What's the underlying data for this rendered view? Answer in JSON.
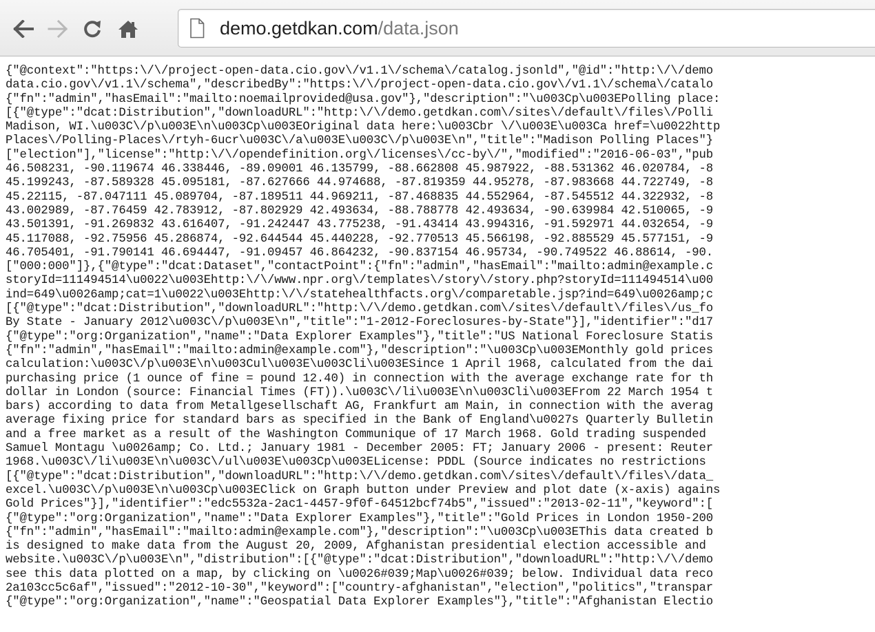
{
  "window": {
    "nav": {
      "back_icon": "arrow-left-icon",
      "forward_icon": "arrow-right-icon",
      "reload_icon": "reload-icon",
      "home_icon": "home-icon"
    },
    "address_bar": {
      "page_icon": "page-icon",
      "host": "demo.getdkan.com",
      "path": "/data.json"
    }
  },
  "document": {
    "lines": [
      "{\"@context\":\"https:\\/\\/project-open-data.cio.gov\\/v1.1\\/schema\\/catalog.jsonld\",\"@id\":\"http:\\/\\/demo",
      "data.cio.gov\\/v1.1\\/schema\",\"describedBy\":\"https:\\/\\/project-open-data.cio.gov\\/v1.1\\/schema\\/catalo",
      "{\"fn\":\"admin\",\"hasEmail\":\"mailto:noemailprovided@usa.gov\"},\"description\":\"\\u003Cp\\u003EPolling place:",
      "[{\"@type\":\"dcat:Distribution\",\"downloadURL\":\"http:\\/\\/demo.getdkan.com\\/sites\\/default\\/files\\/Polli",
      "Madison, WI.\\u003C\\/p\\u003E\\n\\u003Cp\\u003EOriginal data here:\\u003Cbr \\/\\u003E\\u003Ca href=\\u0022http",
      "Places\\/Polling-Places\\/rtyh-6ucr\\u003C\\/a\\u003E\\u003C\\/p\\u003E\\n\",\"title\":\"Madison Polling Places\"}",
      "[\"election\"],\"license\":\"http:\\/\\/opendefinition.org\\/licenses\\/cc-by\\/\",\"modified\":\"2016-06-03\",\"pub",
      "46.508231, -90.119674 46.338446, -89.09001 46.135799, -88.662808 45.987922, -88.531362 46.020784, -8",
      "45.199243, -87.589328 45.095181, -87.627666 44.974688, -87.819359 44.95278, -87.983668 44.722749, -8",
      "45.22115, -87.047111 45.089704, -87.189511 44.969211, -87.468835 44.552964, -87.545512 44.322932, -8",
      "43.002989, -87.76459 42.783912, -87.802929 42.493634, -88.788778 42.493634, -90.639984 42.510065, -9",
      "43.501391, -91.269832 43.616407, -91.242447 43.775238, -91.43414 43.994316, -91.592971 44.032654, -9",
      "45.117088, -92.75956 45.286874, -92.644544 45.440228, -92.770513 45.566198, -92.885529 45.577151, -9",
      "46.705401, -91.790141 46.694447, -91.09457 46.864232, -90.837154 46.95734, -90.749522 46.88614, -90.",
      "[\"000:000\"]},{\"@type\":\"dcat:Dataset\",\"contactPoint\":{\"fn\":\"admin\",\"hasEmail\":\"mailto:admin@example.c",
      "storyId=111494514\\u0022\\u003Ehttp:\\/\\/www.npr.org\\/templates\\/story\\/story.php?storyId=111494514\\u00",
      "ind=649\\u0026amp;cat=1\\u0022\\u003Ehttp:\\/\\/statehealthfacts.org\\/comparetable.jsp?ind=649\\u0026amp;c",
      "[{\"@type\":\"dcat:Distribution\",\"downloadURL\":\"http:\\/\\/demo.getdkan.com\\/sites\\/default\\/files\\/us_fo",
      "By State - January 2012\\u003C\\/p\\u003E\\n\",\"title\":\"1-2012-Foreclosures-by-State\"}],\"identifier\":\"d17",
      "{\"@type\":\"org:Organization\",\"name\":\"Data Explorer Examples\"},\"title\":\"US National Foreclosure Statis",
      "{\"fn\":\"admin\",\"hasEmail\":\"mailto:admin@example.com\"},\"description\":\"\\u003Cp\\u003EMonthly gold prices",
      "calculation:\\u003C\\/p\\u003E\\n\\u003Cul\\u003E\\u003Cli\\u003ESince 1 April 1968, calculated from the dai",
      "purchasing price (1 ounce of fine = pound 12.40) in connection with the average exchange rate for th",
      "dollar in London (source: Financial Times (FT)).\\u003C\\/li\\u003E\\n\\u003Cli\\u003EFrom 22 March 1954 t",
      "bars) according to data from Metallgesellschaft AG, Frankfurt am Main, in connection with the averag",
      "average fixing price for standard bars as specified in the Bank of England\\u0027s Quarterly Bulletin",
      "and a free market as a result of the Washington Communique of 17 March 1968. Gold trading suspended",
      "Samuel Montagu \\u0026amp; Co. Ltd.; January 1981 - December 2005: FT; January 2006 - present: Reuter",
      "1968.\\u003C\\/li\\u003E\\n\\u003C\\/ul\\u003E\\u003Cp\\u003ELicense: PDDL (Source indicates no restrictions",
      "[{\"@type\":\"dcat:Distribution\",\"downloadURL\":\"http:\\/\\/demo.getdkan.com\\/sites\\/default\\/files\\/data_",
      "excel.\\u003C\\/p\\u003E\\n\\u003Cp\\u003EClick on Graph button under Preview and plot date (x-axis) agains",
      "Gold Prices\"}],\"identifier\":\"edc5532a-2ac1-4457-9f0f-64512bcf74b5\",\"issued\":\"2013-02-11\",\"keyword\":[",
      "{\"@type\":\"org:Organization\",\"name\":\"Data Explorer Examples\"},\"title\":\"Gold Prices in London 1950-200",
      "{\"fn\":\"admin\",\"hasEmail\":\"mailto:admin@example.com\"},\"description\":\"\\u003Cp\\u003EThis data created b",
      "is designed to make data from the August 20, 2009, Afghanistan presidential election accessible and",
      "website.\\u003C\\/p\\u003E\\n\",\"distribution\":[{\"@type\":\"dcat:Distribution\",\"downloadURL\":\"http:\\/\\/demo",
      "see this data plotted on a map, by clicking on \\u0026#039;Map\\u0026#039; below. Individual data reco",
      "2a103cc5c6af\",\"issued\":\"2012-10-30\",\"keyword\":[\"country-afghanistan\",\"election\",\"politics\",\"transpar",
      "{\"@type\":\"org:Organization\",\"name\":\"Geospatial Data Explorer Examples\"},\"title\":\"Afghanistan Electio"
    ]
  }
}
